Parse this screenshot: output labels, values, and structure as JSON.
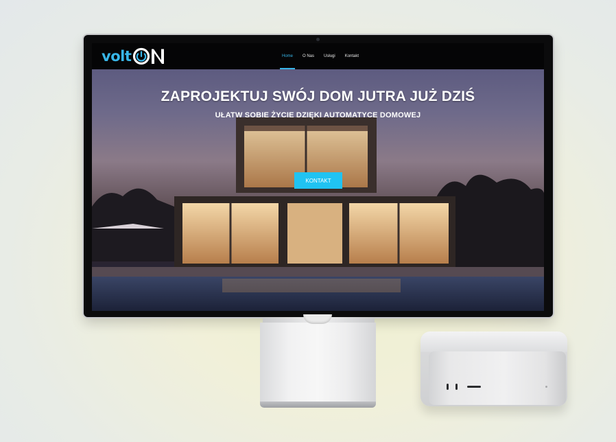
{
  "brand": {
    "logo_part1": "volt",
    "logo_part2": "ON",
    "accent": "#38b6e8"
  },
  "nav": {
    "items": [
      {
        "label": "Home",
        "active": true
      },
      {
        "label": "O Nas",
        "active": false
      },
      {
        "label": "Usługi",
        "active": false
      },
      {
        "label": "Kontakt",
        "active": false
      }
    ]
  },
  "hero": {
    "title": "ZAPROJEKTUJ SWÓJ DOM JUTRA JUŻ DZIŚ",
    "subtitle": "UŁATW SOBIE ŻYCIE DZIĘKI AUTOMATYCE DOMOWEJ",
    "cta_label": "KONTAKT",
    "cta_color": "#20c3f2"
  }
}
